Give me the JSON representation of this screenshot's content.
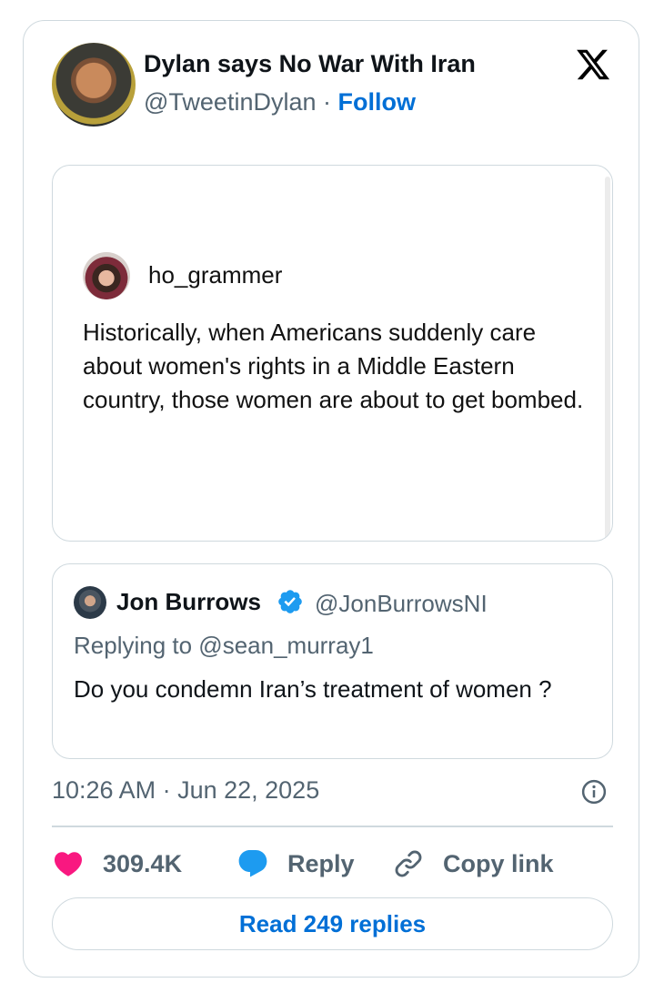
{
  "author": {
    "display_name": "Dylan says No War With Iran",
    "handle": "@TweetinDylan",
    "separator": "·",
    "follow_label": "Follow"
  },
  "media": {
    "username": "ho_grammer",
    "text": "Historically, when Americans suddenly care about women's rights in a Middle Eastern country, those women are about to get bombed."
  },
  "quoted_tweet": {
    "display_name": "Jon Burrows",
    "handle": "@JonBurrowsNI",
    "replying_to": "Replying to @sean_murray1",
    "text": "Do you condemn Iran’s treatment of women ?"
  },
  "timestamp": "10:26 AM · Jun 22, 2025",
  "actions": {
    "like_count": "309.4K",
    "reply_label": "Reply",
    "copy_label": "Copy link"
  },
  "read_replies_label": "Read 249 replies",
  "colors": {
    "accent": "#006fd6",
    "like": "#f91880",
    "reply": "#1d9bf0",
    "border": "#cfd9de",
    "secondary_text": "#536471"
  }
}
